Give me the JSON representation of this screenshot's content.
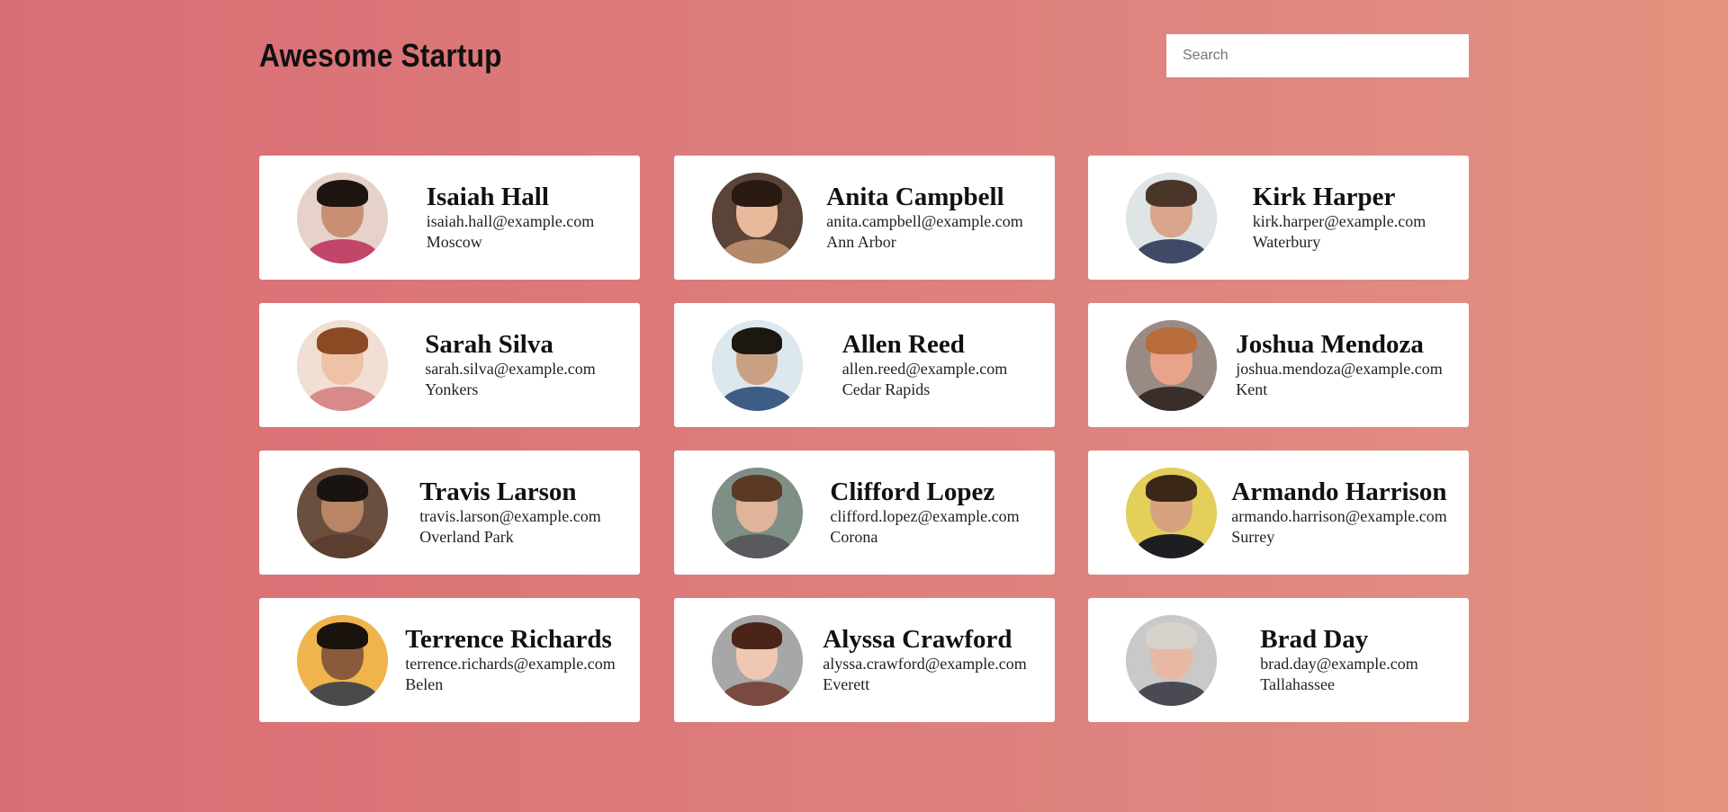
{
  "header": {
    "title": "Awesome Startup",
    "search_placeholder": "Search"
  },
  "employees": [
    {
      "name": "Isaiah Hall",
      "email": "isaiah.hall@example.com",
      "city": "Moscow",
      "avatar": {
        "bg": "#e6d2c8",
        "skin": "#c98f74",
        "hair": "#1f1510",
        "shirt": "#c2456a"
      }
    },
    {
      "name": "Anita Campbell",
      "email": "anita.campbell@example.com",
      "city": "Ann Arbor",
      "avatar": {
        "bg": "#5b4338",
        "skin": "#e8b99a",
        "hair": "#2a1a12",
        "shirt": "#b48a6a"
      }
    },
    {
      "name": "Kirk Harper",
      "email": "kirk.harper@example.com",
      "city": "Waterbury",
      "avatar": {
        "bg": "#dfe4e6",
        "skin": "#d9a58b",
        "hair": "#4a3628",
        "shirt": "#3e4a66"
      }
    },
    {
      "name": "Sarah Silva",
      "email": "sarah.silva@example.com",
      "city": "Yonkers",
      "avatar": {
        "bg": "#f1dfd4",
        "skin": "#efc1a6",
        "hair": "#8a4a24",
        "shirt": "#d88a8a"
      }
    },
    {
      "name": "Allen Reed",
      "email": "allen.reed@example.com",
      "city": "Cedar Rapids",
      "avatar": {
        "bg": "#dde7ee",
        "skin": "#caa083",
        "hair": "#1d1712",
        "shirt": "#3d5c86"
      }
    },
    {
      "name": "Joshua Mendoza",
      "email": "joshua.mendoza@example.com",
      "city": "Kent",
      "avatar": {
        "bg": "#9a8a84",
        "skin": "#e7a48a",
        "hair": "#b86b3b",
        "shirt": "#3a2e2a"
      }
    },
    {
      "name": "Travis Larson",
      "email": "travis.larson@example.com",
      "city": "Overland Park",
      "avatar": {
        "bg": "#6a4e3e",
        "skin": "#b88666",
        "hair": "#1a1410",
        "shirt": "#5c3e30"
      }
    },
    {
      "name": "Clifford Lopez",
      "email": "clifford.lopez@example.com",
      "city": "Corona",
      "avatar": {
        "bg": "#7e8f86",
        "skin": "#e0b49a",
        "hair": "#5a3a24",
        "shirt": "#5a5a5e"
      }
    },
    {
      "name": "Armando Harrison",
      "email": "armando.harrison@example.com",
      "city": "Surrey",
      "avatar": {
        "bg": "#e3cf5a",
        "skin": "#d7a37f",
        "hair": "#3b2718",
        "shirt": "#1e1e22"
      }
    },
    {
      "name": "Terrence Richards",
      "email": "terrence.richards@example.com",
      "city": "Belen",
      "avatar": {
        "bg": "#f0b44c",
        "skin": "#8a5a3a",
        "hair": "#1a120c",
        "shirt": "#4a4a4a"
      }
    },
    {
      "name": "Alyssa Crawford",
      "email": "alyssa.crawford@example.com",
      "city": "Everett",
      "avatar": {
        "bg": "#a7a7a7",
        "skin": "#efc8b4",
        "hair": "#4a2418",
        "shirt": "#7a4a40"
      }
    },
    {
      "name": "Brad Day",
      "email": "brad.day@example.com",
      "city": "Tallahassee",
      "avatar": {
        "bg": "#c9c9c9",
        "skin": "#e7b9a4",
        "hair": "#d8d2cc",
        "shirt": "#4a4a52"
      }
    }
  ]
}
